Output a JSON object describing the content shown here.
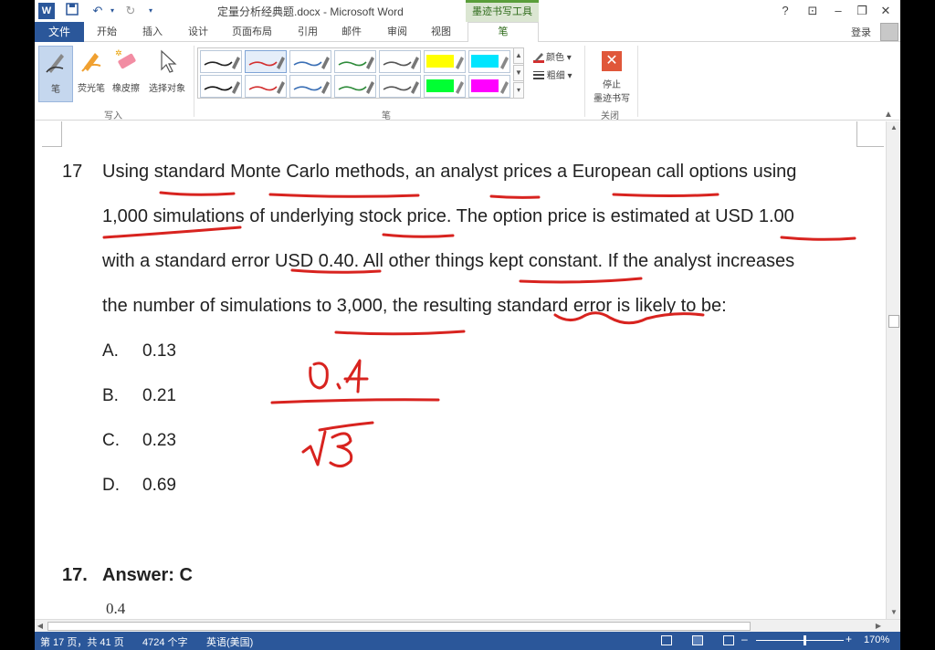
{
  "titlebar": {
    "doc_title": "定量分析经典题.docx - Microsoft Word",
    "context_tab_title": "墨迹书写工具",
    "help_label": "?",
    "restore_ribbon_label": "⊡",
    "minimize_label": "–",
    "maximize_label": "❐",
    "close_label": "✕"
  },
  "tabs": {
    "file": "文件",
    "items": [
      "开始",
      "插入",
      "设计",
      "页面布局",
      "引用",
      "邮件",
      "审阅",
      "视图"
    ],
    "active": "笔",
    "login": "登录"
  },
  "ribbon": {
    "write_group": {
      "label": "写入",
      "pen": "笔",
      "highlighter": "荧光笔",
      "eraser": "橡皮擦",
      "select_objects": "选择对象"
    },
    "pens_group": {
      "label": "笔",
      "color_label": "颜色",
      "thickness_label": "粗细"
    },
    "close_group": {
      "label": "关闭",
      "stop_inking_line1": "停止",
      "stop_inking_line2": "墨迹书写"
    },
    "pen_swatches": [
      {
        "color": "#222222",
        "highlight": false
      },
      {
        "color": "#d32f2f",
        "highlight": false
      },
      {
        "color": "#3a6fb5",
        "highlight": false
      },
      {
        "color": "#2e8b3a",
        "highlight": false
      },
      {
        "color": "#555555",
        "highlight": false
      },
      {
        "color": "#ffff00",
        "highlight": true
      },
      {
        "color": "#00e5ff",
        "highlight": true
      },
      {
        "color": "#111111",
        "highlight": false
      },
      {
        "color": "#d32f2f",
        "highlight": false
      },
      {
        "color": "#3a6fb5",
        "highlight": false
      },
      {
        "color": "#2e8b3a",
        "highlight": false
      },
      {
        "color": "#555555",
        "highlight": false
      },
      {
        "color": "#00ff33",
        "highlight": true
      },
      {
        "color": "#ff00ff",
        "highlight": true
      }
    ]
  },
  "document": {
    "question_number": "17",
    "question_lines": [
      "Using standard Monte Carlo methods, an analyst prices a European call options using",
      "1,000 simulations of underlying stock price. The option price is estimated at USD 1.00",
      "with a standard error USD 0.40. All other things kept constant. If the analyst increases",
      "the number of simulations to 3,000, the resulting standard error is likely to be:"
    ],
    "options": [
      {
        "letter": "A.",
        "value": "0.13"
      },
      {
        "letter": "B.",
        "value": "0.21"
      },
      {
        "letter": "C.",
        "value": "0.23"
      },
      {
        "letter": "D.",
        "value": "0.69"
      }
    ],
    "ink_numerator": "0.4",
    "ink_denominator": "√3",
    "answer_number": "17.",
    "answer_text": "Answer: C",
    "answer_partial": "0.4"
  },
  "statusbar": {
    "page": "第 17 页，共 41 页",
    "words": "4724 个字",
    "language": "英语(美国)",
    "zoom": "170%"
  },
  "colors": {
    "accent": "#2b579a",
    "ink_red": "#d8231f",
    "context_green": "#5a9e3a"
  }
}
